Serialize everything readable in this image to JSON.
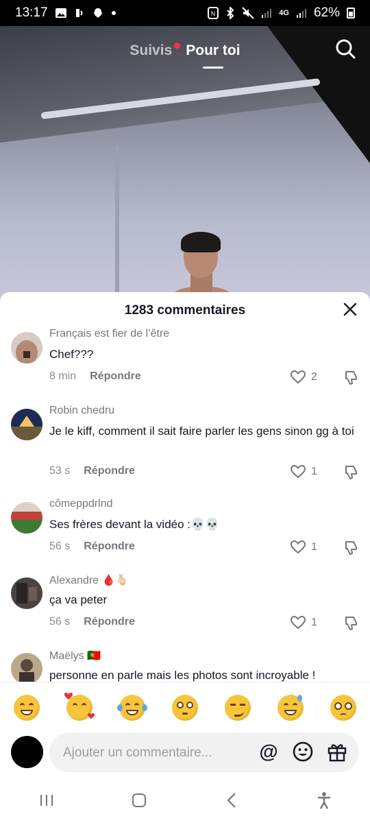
{
  "status_bar": {
    "time": "13:17",
    "battery": "62%",
    "network": "4G",
    "icons": [
      "image-icon",
      "audio-icon",
      "snapchat-icon",
      "dot-icon",
      "nfc-icon",
      "bluetooth-icon",
      "mute-icon",
      "signal-icon",
      "signal-icon",
      "battery-icon"
    ]
  },
  "top_nav": {
    "following": "Suivis",
    "for_you": "Pour toi",
    "notification_dot_color": "#fe2c55"
  },
  "sheet": {
    "title": "1283 commentaires",
    "comments": [
      {
        "user": "Français est fier de l’être",
        "text": "Chef???",
        "time": "8 min",
        "reply": "Répondre",
        "likes": "2",
        "avatar_color": "#b58a72"
      },
      {
        "user": "Robin  chedru",
        "text": "Je le kiff, comment il sait faire parler les gens sinon gg à toi",
        "time": "53 s",
        "reply": "Répondre",
        "likes": "1",
        "avatar_color": "#2b3a6b"
      },
      {
        "user": "cômeppdrlnd",
        "text": "Ses frères devant la vidéo :💀💀",
        "time": "56 s",
        "reply": "Répondre",
        "likes": "1",
        "avatar_color": "#c2413a"
      },
      {
        "user": "Alexandre 🩸🫰🏻",
        "text": "ça va peter",
        "time": "56 s",
        "reply": "Répondre",
        "likes": "1",
        "avatar_color": "#3a3431"
      },
      {
        "user": "Maëlys 🇵🇹",
        "text": "personne en parle mais les photos sont incroyable !",
        "time": "",
        "reply": "",
        "likes": "",
        "avatar_color": "#8a7a62"
      }
    ],
    "emojis": [
      "grin",
      "smiling-hearts",
      "tears-of-joy",
      "flushed",
      "smirk",
      "sweat-smile",
      "pleading"
    ],
    "input_placeholder": "Ajouter un commentaire...",
    "at_label": "@"
  },
  "colors": {
    "text_primary": "#161823",
    "text_secondary": "#75767d",
    "accent": "#fe2c55"
  }
}
